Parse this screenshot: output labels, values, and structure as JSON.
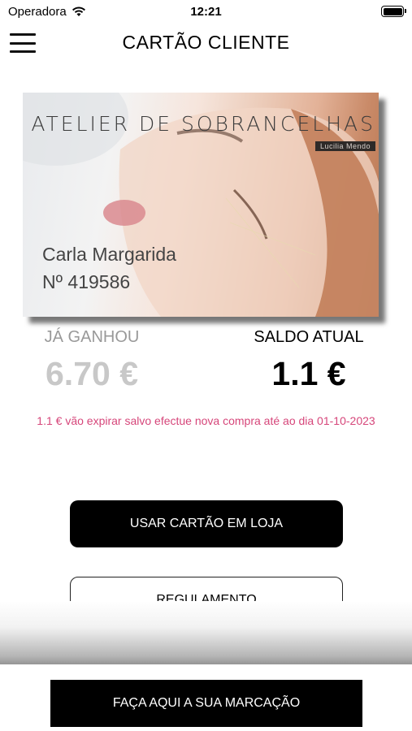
{
  "status_bar": {
    "carrier": "Operadora",
    "time": "12:21",
    "icons": [
      "wifi-icon",
      "battery-icon"
    ]
  },
  "nav": {
    "title": "CARTÃO CLIENTE",
    "menu_icon": "hamburger-menu-icon"
  },
  "card": {
    "brand": "ATELIER DE SOBRANCELHAS",
    "sub_brand": "Lucilia Mendo",
    "holder_name": "Carla Margarida",
    "card_number": "Nº 419586"
  },
  "stats": {
    "earned_label": "JÁ GANHOU",
    "earned_value": "6.70 €",
    "balance_label": "SALDO ATUAL",
    "balance_value": "1.1 €"
  },
  "expire_note": "1.1 € vão expirar salvo efectue nova compra até ao dia 01-10-2023",
  "buttons": {
    "use_card": "USAR CARTÃO EM LOJA",
    "rules": "REGULAMENTO",
    "booking": "FAÇA AQUI A SUA MARCAÇÃO"
  },
  "colors": {
    "accent_pink": "#d6467a",
    "dark": "#000000",
    "muted_gray": "#c8c8c8"
  }
}
